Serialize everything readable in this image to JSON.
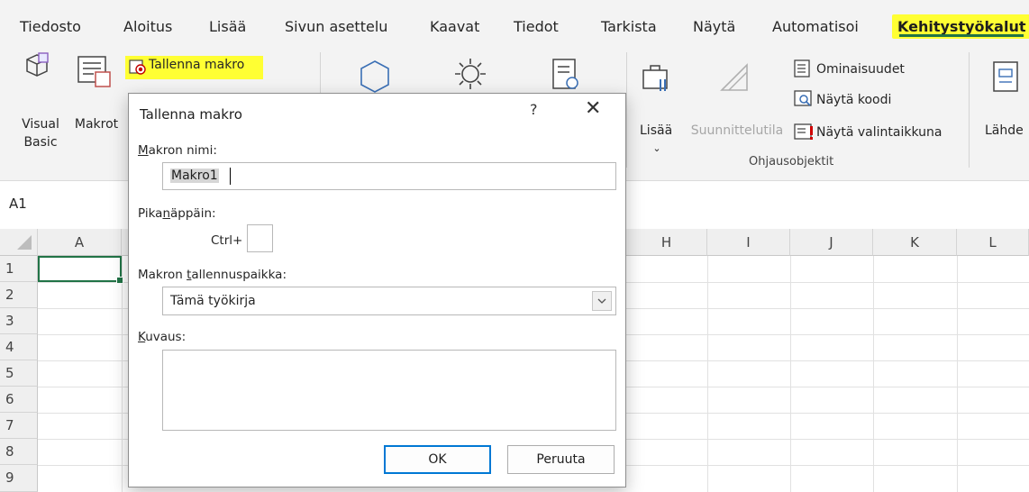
{
  "tabs": [
    "Tiedosto",
    "Aloitus",
    "Lisää",
    "Sivun asettelu",
    "Kaavat",
    "Tiedot",
    "Tarkista",
    "Näytä",
    "Automatisoi",
    "Kehitystyökalut"
  ],
  "active_tab": "Kehitystyökalut",
  "ribbon": {
    "visual_basic": [
      "Visual",
      "Basic"
    ],
    "macros": "Makrot",
    "record_macro": "Tallenna makro",
    "insert": "Lisää",
    "design_mode": "Suunnittelutila",
    "properties": "Ominaisuudet",
    "view_code": "Näytä koodi",
    "run_dialog": "Näytä valintaikkuna",
    "source": "Lähde",
    "controls_group": "Ohjausobjektit"
  },
  "name_box": "A1",
  "columns": [
    "A",
    "H",
    "I",
    "J",
    "K",
    "L"
  ],
  "rows": [
    "1",
    "2",
    "3",
    "4",
    "5",
    "6",
    "7",
    "8",
    "9"
  ],
  "dialog": {
    "title": "Tallenna makro",
    "help": "?",
    "close": "✕",
    "macro_name_label_pre": "M",
    "macro_name_label_rest": "akron nimi:",
    "macro_name_value": "Makro1",
    "shortcut_label_pre": "Pika",
    "shortcut_label_u": "n",
    "shortcut_label_rest": "äppäin:",
    "ctrl": "Ctrl+",
    "store_label_pre": "Makron ",
    "store_label_u": "t",
    "store_label_rest": "allennuspaikka:",
    "store_value": "Tämä työkirja",
    "desc_label_pre": "K",
    "desc_label_rest": "uvaus:",
    "ok": "OK",
    "cancel": "Peruuta"
  },
  "colors": {
    "accent": "#217346",
    "highlight": "#ffff33",
    "primary_button": "#0078d4"
  }
}
